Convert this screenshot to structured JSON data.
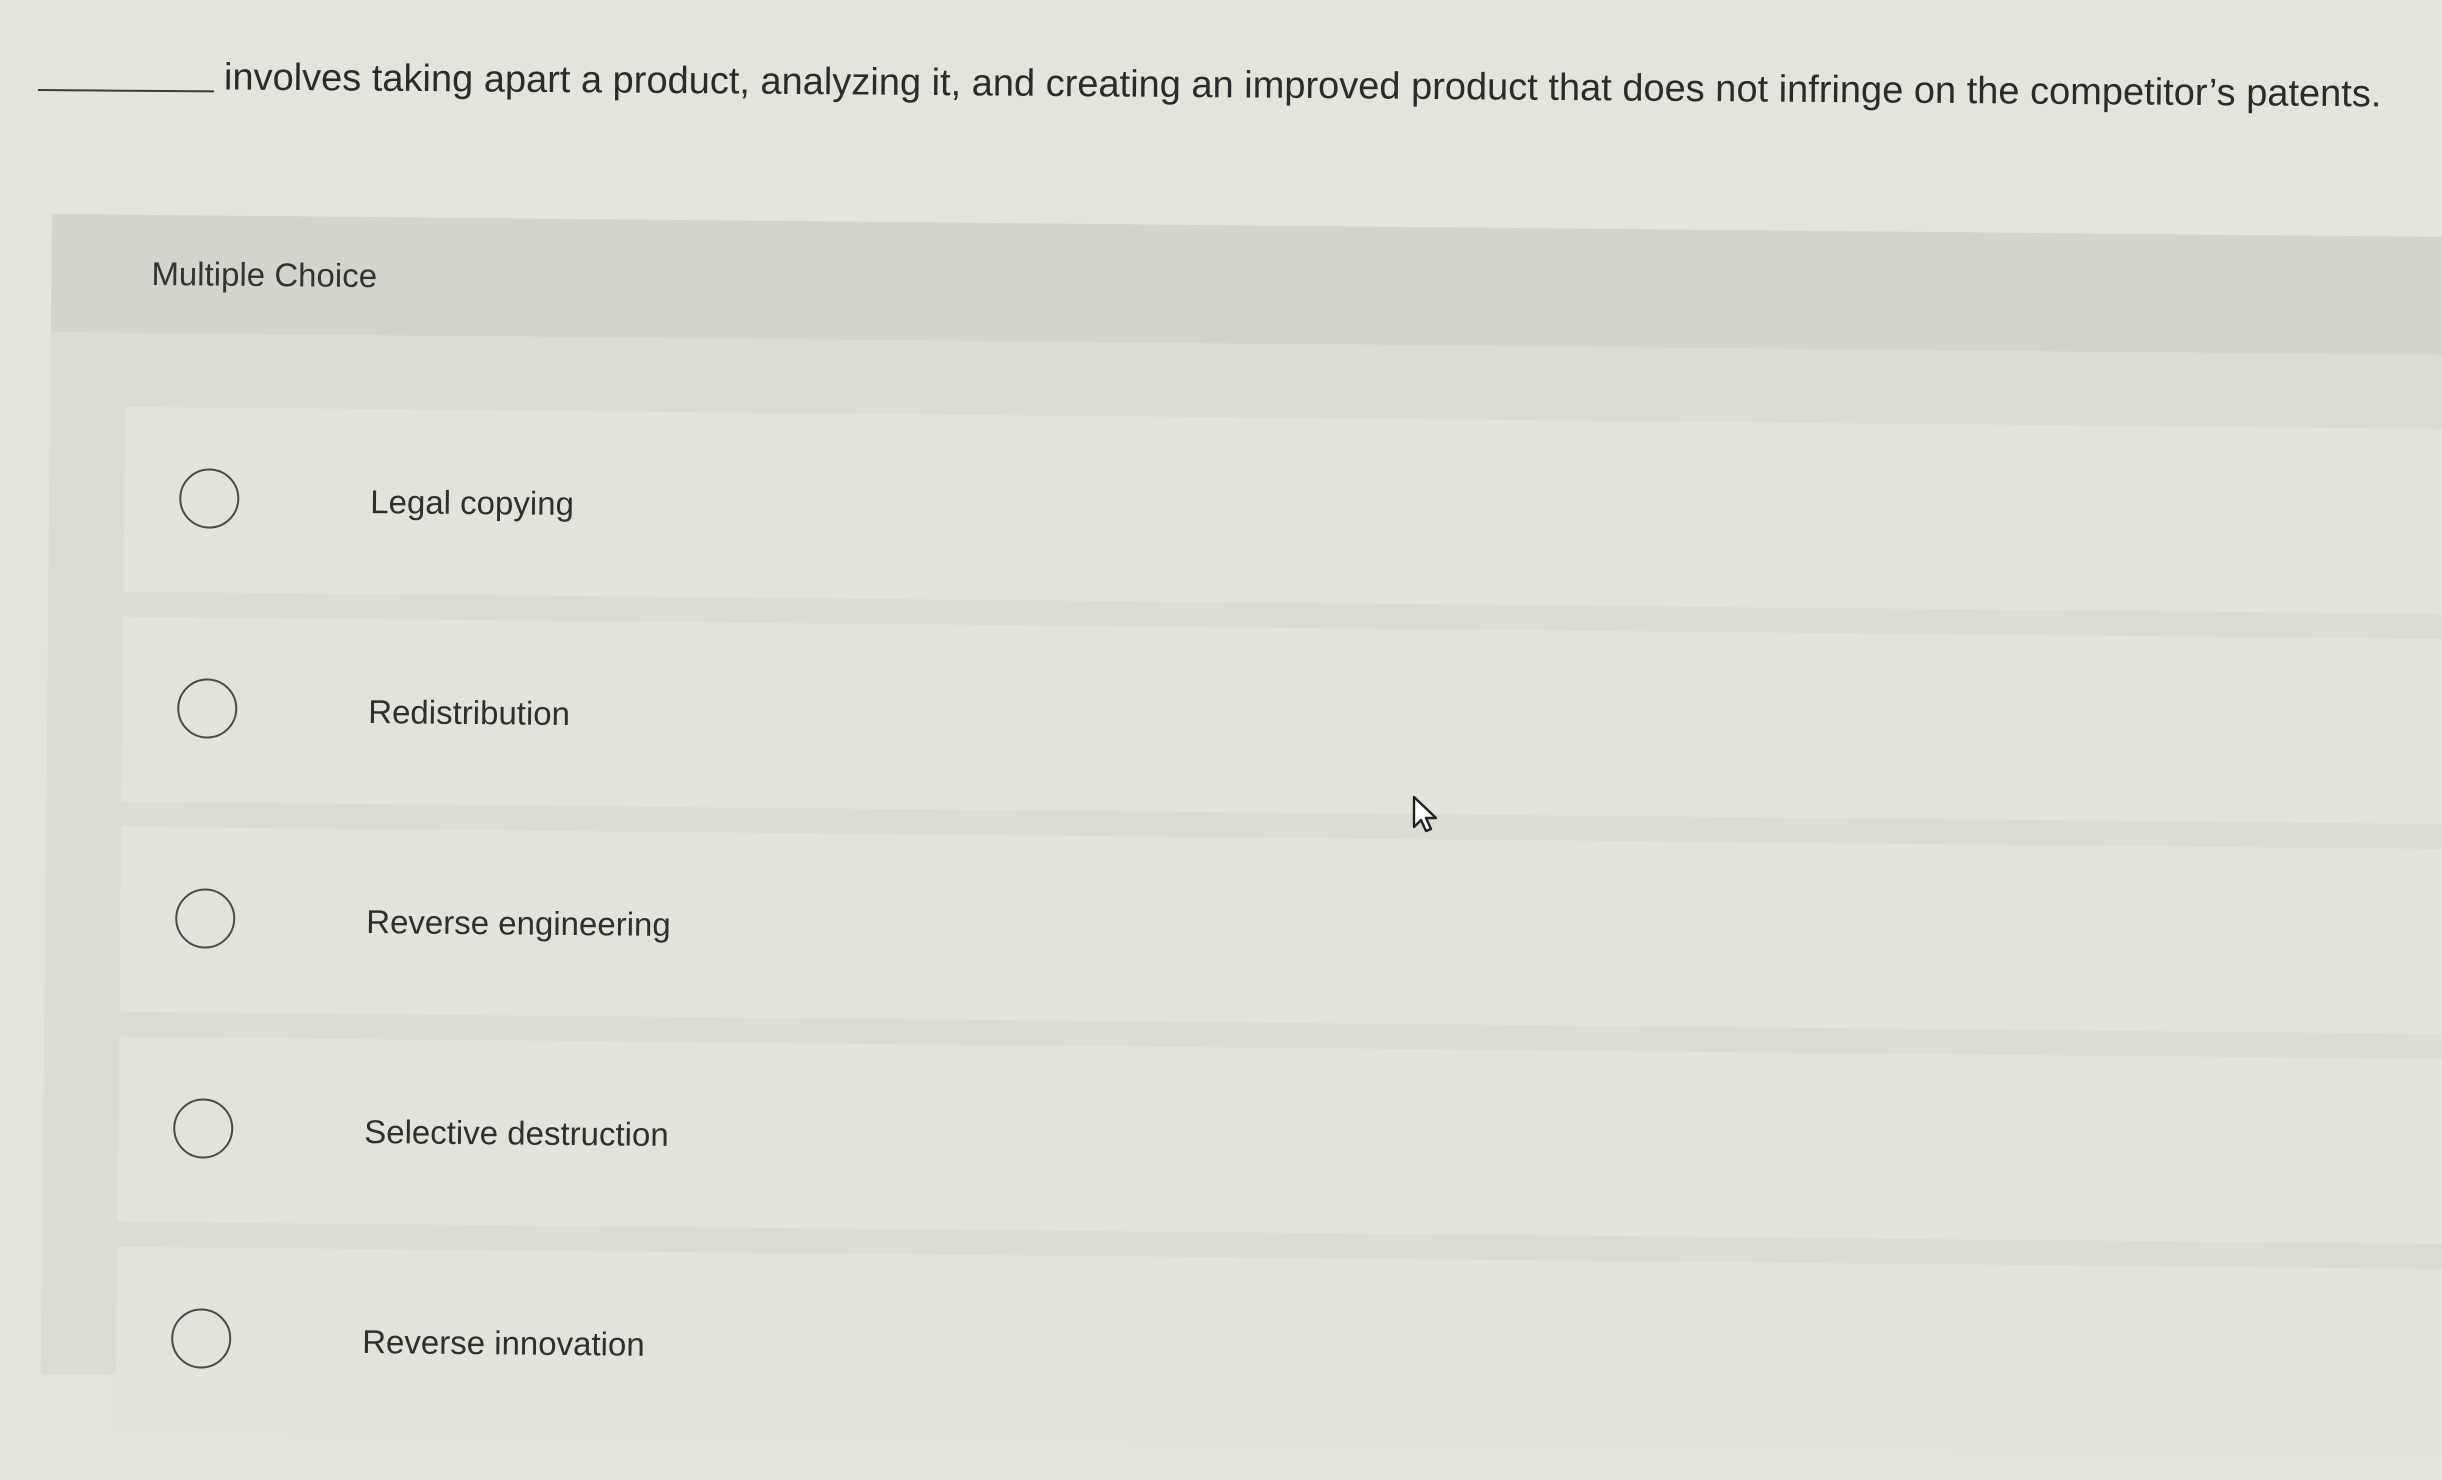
{
  "question": {
    "text": "involves taking apart a product, analyzing it, and creating an improved product that does not infringe on the competitor’s patents."
  },
  "panel": {
    "label": "Multiple Choice"
  },
  "options": [
    {
      "label": "Legal copying"
    },
    {
      "label": "Redistribution"
    },
    {
      "label": "Reverse engineering"
    },
    {
      "label": "Selective destruction"
    },
    {
      "label": "Reverse innovation"
    }
  ],
  "icons": {
    "radio": "radio-empty-icon",
    "cursor": "mouse-pointer-icon"
  }
}
